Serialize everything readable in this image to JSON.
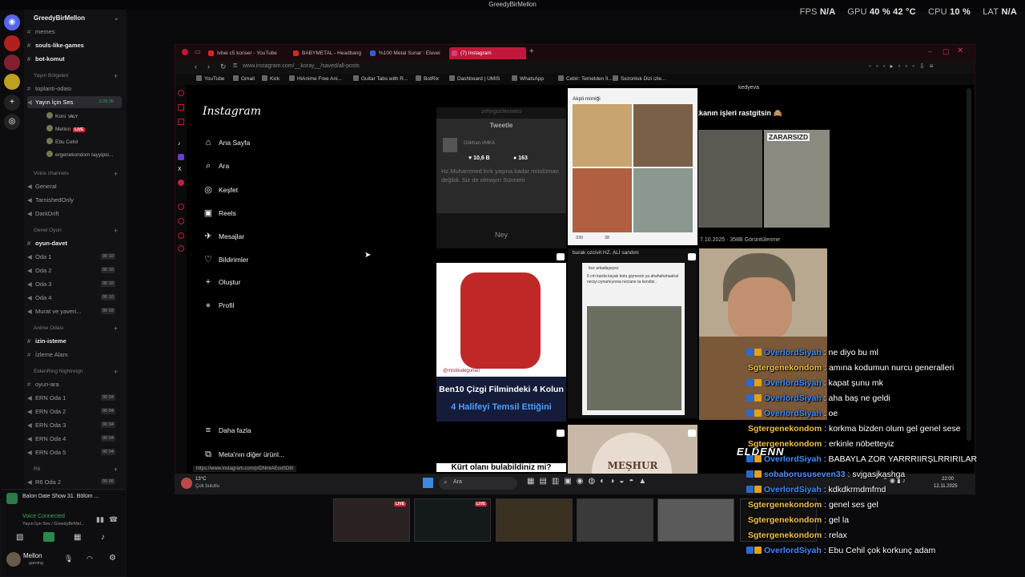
{
  "window_title": "GreedyBirMellon",
  "stats": {
    "fps_label": "FPS",
    "fps": "N/A",
    "gpu_label": "GPU",
    "gpu": "40 % 42 °C",
    "cpu_label": "CPU",
    "cpu": "10 %",
    "lat_label": "LAT",
    "lat": "N/A"
  },
  "discord": {
    "server": "GreedyBirMellon",
    "channels": [
      {
        "label": "memes"
      },
      {
        "label": "souls-like-games"
      },
      {
        "label": "bot-komut"
      },
      {
        "label": "Yayın Bölgeleri"
      },
      {
        "label": "toplantı-odası"
      },
      {
        "label": "Yayın İçin Ses",
        "time": "2:26:36"
      },
      {
        "label": "Koni",
        "tag": "VALY"
      },
      {
        "label": "Mellon",
        "live": "LIVE"
      },
      {
        "label": "Ebu Cehil"
      },
      {
        "label": "ergenekondom tayyipsi..."
      },
      {
        "label": "Voice channels"
      },
      {
        "label": "General"
      },
      {
        "label": "TarnishedOnly"
      },
      {
        "label": "DarkDrift"
      },
      {
        "label": "Genel Oyun"
      },
      {
        "label": "oyun-davet"
      },
      {
        "label": "Oda 1",
        "a": "00",
        "b": "10"
      },
      {
        "label": "Oda 2",
        "a": "00",
        "b": "10"
      },
      {
        "label": "Oda 3",
        "a": "00",
        "b": "10"
      },
      {
        "label": "Oda 4",
        "a": "00",
        "b": "10"
      },
      {
        "label": "Murat ve yaveri...",
        "a": "00",
        "b": "03"
      },
      {
        "label": "Anime Odası"
      },
      {
        "label": "izin-isteme"
      },
      {
        "label": "İzleme Alanı"
      },
      {
        "label": "EldenRing Nightreign"
      },
      {
        "label": "oyun-ara"
      },
      {
        "label": "ERN Oda 1",
        "a": "00",
        "b": "04"
      },
      {
        "label": "ERN Oda 2",
        "a": "00",
        "b": "04"
      },
      {
        "label": "ERN Oda 3",
        "a": "00",
        "b": "04"
      },
      {
        "label": "ERN Oda 4",
        "a": "00",
        "b": "04"
      },
      {
        "label": "ERN Oda 5",
        "a": "00",
        "b": "04"
      },
      {
        "label": "R6"
      },
      {
        "label": "R6 Oda 2",
        "a": "00",
        "b": "05"
      }
    ],
    "activity": "Balon Date Show 31. Bölüm ...",
    "voice_status": "Voice Connected",
    "voice_channel": "Yayın İçin Ses / GreedyBirMel...",
    "username": "Mellon",
    "user_status": "gaming"
  },
  "browser": {
    "tabs": [
      {
        "label": "Ivbei c5 konser - YouTube",
        "color": "#e02020"
      },
      {
        "label": "BABYMETAL - Headbang",
        "color": "#e02020"
      },
      {
        "label": "%100 Metal Sunar : Eluvei",
        "color": "#3060d0"
      },
      {
        "label": "(7) Instagram",
        "color": "#d04080"
      }
    ],
    "url": "www.instagram.com/__koray__/saved/all-posts",
    "bookmarks": [
      "YouTube",
      "Gmail",
      "Kick",
      "HiAnime Free Ani...",
      "Guitar Tabs with R...",
      "BotRix",
      "Dashboard | UMIS",
      "WhatsApp",
      "Cebir: Temelden İl...",
      "Sezonluk Dizi izle..."
    ],
    "status_url": "https://www.instagram.com/p/DNmiAEooSD8/"
  },
  "instagram": {
    "logo": "Instagram",
    "nav": [
      {
        "label": "Ana Sayfa",
        "icon": "⌂"
      },
      {
        "label": "Ara",
        "icon": "⌕"
      },
      {
        "label": "Keşfet",
        "icon": "◎"
      },
      {
        "label": "Reels",
        "icon": "▣"
      },
      {
        "label": "Mesajlar",
        "icon": "✈"
      },
      {
        "label": "Bildirimler",
        "icon": "♡"
      },
      {
        "label": "Oluştur",
        "icon": "+"
      },
      {
        "label": "Profil",
        "icon": "●"
      }
    ],
    "more": "Daha fazla",
    "meta": "Meta'nın diğer ürünl...",
    "posts": {
      "tweet_user": "zehirguclenmesi",
      "tweet_header": "Tweetle",
      "tweet_name": "Gökhan #MKA",
      "tweet_likes": "10,6 B",
      "tweet_comments": "163",
      "tweet_text": "Hz.Muhammed kırk yaşına kadar müslüman değildi. Siz de olmayın Sünnetir",
      "tweet_caption": "Ney",
      "akpli": "Akpli mimiği",
      "akpli_likes": "330",
      "akpli_comments": "38",
      "kedi_user": "kedyeva",
      "kedi_caption": "kkanın işleri rastgitsin 🙈",
      "kedi_sign": "ZARARSIZD",
      "kedi_date": "7.10.2025 · 358B Görüntülenme",
      "ben10_user": "@mistikalegorlari",
      "ben10_line1": "Ben10 Çizgi Filmindeki 4 Kolun",
      "ben10_line2": "4 Halifeyi Temsil Ettiğini",
      "ali_caption": "burak ozcivit HZ. ALİ sandım",
      "ali_user": "koz arkadaşeyez",
      "ali_text": "5 cm karda kayak botu giymesin ya ahahahahaahal neciyi oynamıyorsa neciane ta kendisi..",
      "kurt": "Kürt olanı bulabildiniz mi?",
      "meshur": "MEŞHUR"
    }
  },
  "taskbar": {
    "search": "Ara",
    "weather_temp": "13°C",
    "weather_text": "Çok bulutlu",
    "time": "22:00",
    "date": "12.11.2025"
  },
  "overlay": {
    "elden": "ELDENN"
  },
  "chat": [
    {
      "user": "OverlordSiyah",
      "text": "ne diyo bu ml",
      "c": "u1",
      "b": true
    },
    {
      "user": "Sgtergenekondom",
      "text": "amına kodumun nurcu generalleri",
      "c": "u2",
      "b": false
    },
    {
      "user": "OverlordSiyah",
      "text": "kapat şunu mk",
      "c": "u1",
      "b": true
    },
    {
      "user": "OverlordSiyah",
      "text": "aha baş ne geldi",
      "c": "u1",
      "b": true
    },
    {
      "user": "OverlordSiyah",
      "text": "oe",
      "c": "u1",
      "b": true
    },
    {
      "user": "Sgtergenekondom",
      "text": "korkma bizden olum gel genel sese",
      "c": "u2",
      "b": false
    },
    {
      "user": "Sgtergenekondom",
      "text": "erkinle nöbetteyiz",
      "c": "u2",
      "b": false
    },
    {
      "user": "OverlordSiyah",
      "text": "BABAYLA ZOR YARRRIIRŞLRRIRILAR",
      "c": "u1",
      "b": true
    },
    {
      "user": "sobaborususeven33",
      "text": "svjgasjkashga",
      "c": "u3",
      "b": true
    },
    {
      "user": "OverlordSiyah",
      "text": "kdkdkrmdmfmd",
      "c": "u1",
      "b": true
    },
    {
      "user": "Sgtergenekondom",
      "text": "genel ses gel",
      "c": "u2",
      "b": false
    },
    {
      "user": "Sgtergenekondom",
      "text": "gel la",
      "c": "u2",
      "b": false
    },
    {
      "user": "Sgtergenekondom",
      "text": "relax",
      "c": "u2",
      "b": false
    },
    {
      "user": "OverlordSiyah",
      "text": "Ebu Cehil çok korkunç adam",
      "c": "u1",
      "b": true
    }
  ],
  "thumbs": [
    {
      "live": "LIVE"
    },
    {
      "live": "LIVE"
    },
    {},
    {},
    {},
    {}
  ]
}
